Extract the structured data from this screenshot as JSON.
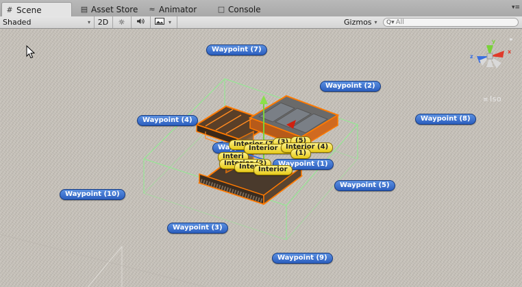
{
  "tabs": [
    {
      "label": "Scene",
      "icon": "grid-icon"
    },
    {
      "label": "Asset Store",
      "icon": "store-icon"
    },
    {
      "label": "Animator",
      "icon": "animator-icon"
    },
    {
      "label": "Console",
      "icon": "console-icon"
    }
  ],
  "toolbar": {
    "shading_mode": "Shaded",
    "mode_2d": "2D",
    "gizmos_label": "Gizmos",
    "search_prefix": "Q▾",
    "search_placeholder": "All"
  },
  "scene": {
    "waypoints": [
      "Waypoint (7)",
      "Waypoint (2)",
      "Waypoint (4)",
      "Waypoint (8)",
      "Waypoint (6)",
      "Waypoint (1)",
      "Waypoint (5)",
      "Waypoint (10)",
      "Waypoint (3)",
      "Waypoint (9)"
    ],
    "interior_labels": [
      "Interior (7)",
      "(3)",
      "(5)",
      "Interior (9)",
      "Interior (4)",
      "Interi",
      "(1)",
      "Interior (2)",
      "Inter",
      "Interior"
    ],
    "projection_label": "Iso"
  },
  "colors": {
    "waypoint_badge": "#3a6fd0",
    "interior_badge": "#f3dd40",
    "selection_outline": "#ff7a00",
    "bounds_wire": "#8cf08c",
    "gizmo_x": "#e03a2a",
    "gizmo_y": "#7ad23a",
    "gizmo_z": "#3a6fe0"
  }
}
